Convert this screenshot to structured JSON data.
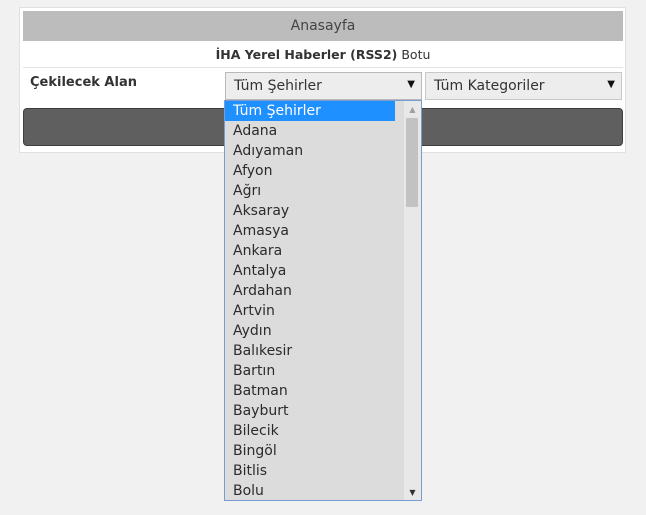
{
  "header": {
    "title": "Anasayfa"
  },
  "subtitle": {
    "bold": "İHA Yerel Haberler (RSS2)",
    "rest": "Botu"
  },
  "form": {
    "field_label": "Çekilecek Alan",
    "city_select": {
      "value": "Tüm Şehirler"
    },
    "category_select": {
      "value": "Tüm Kategoriler"
    }
  },
  "dropdown": {
    "selected_index": 0,
    "options": [
      "Tüm Şehirler",
      "Adana",
      "Adıyaman",
      "Afyon",
      "Ağrı",
      "Aksaray",
      "Amasya",
      "Ankara",
      "Antalya",
      "Ardahan",
      "Artvin",
      "Aydın",
      "Balıkesir",
      "Bartın",
      "Batman",
      "Bayburt",
      "Bilecik",
      "Bingöl",
      "Bitlis",
      "Bolu"
    ]
  },
  "icons": {
    "select_arrow": "▼",
    "scroll_up": "▲",
    "scroll_down": "▼"
  },
  "colors": {
    "selected_option": "#1e90ff",
    "header_bar": "#bcbcbc",
    "submit_bar": "#5f5f5f"
  }
}
